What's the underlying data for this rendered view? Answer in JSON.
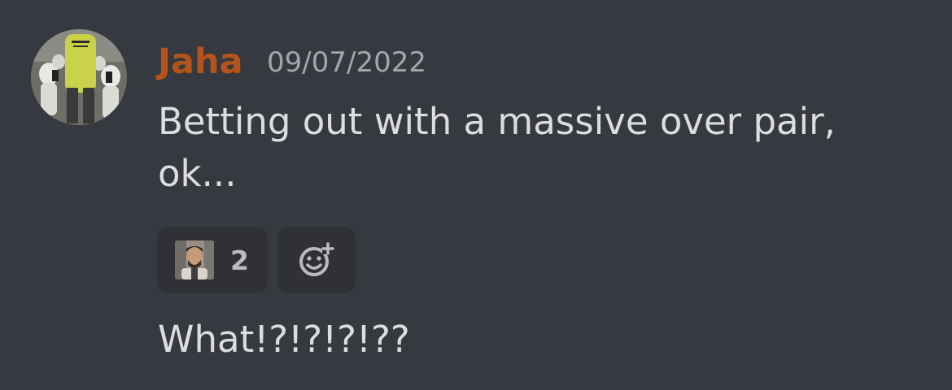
{
  "message_group": {
    "author": {
      "name": "Jaha",
      "color": "#b4541c"
    },
    "timestamp": "09/07/2022",
    "messages": [
      {
        "text": "Betting out with a massive over pair, ok..."
      },
      {
        "text": "What!?!?!?!??"
      }
    ],
    "reactions": [
      {
        "emoji": "custom-face-emoji",
        "count": "2"
      }
    ],
    "add_reaction_icon": "add-reaction-icon"
  },
  "colors": {
    "background": "#36393f",
    "reaction_background": "#2f3136",
    "message_text": "#dcddde",
    "timestamp_text": "#a3a6aa"
  }
}
